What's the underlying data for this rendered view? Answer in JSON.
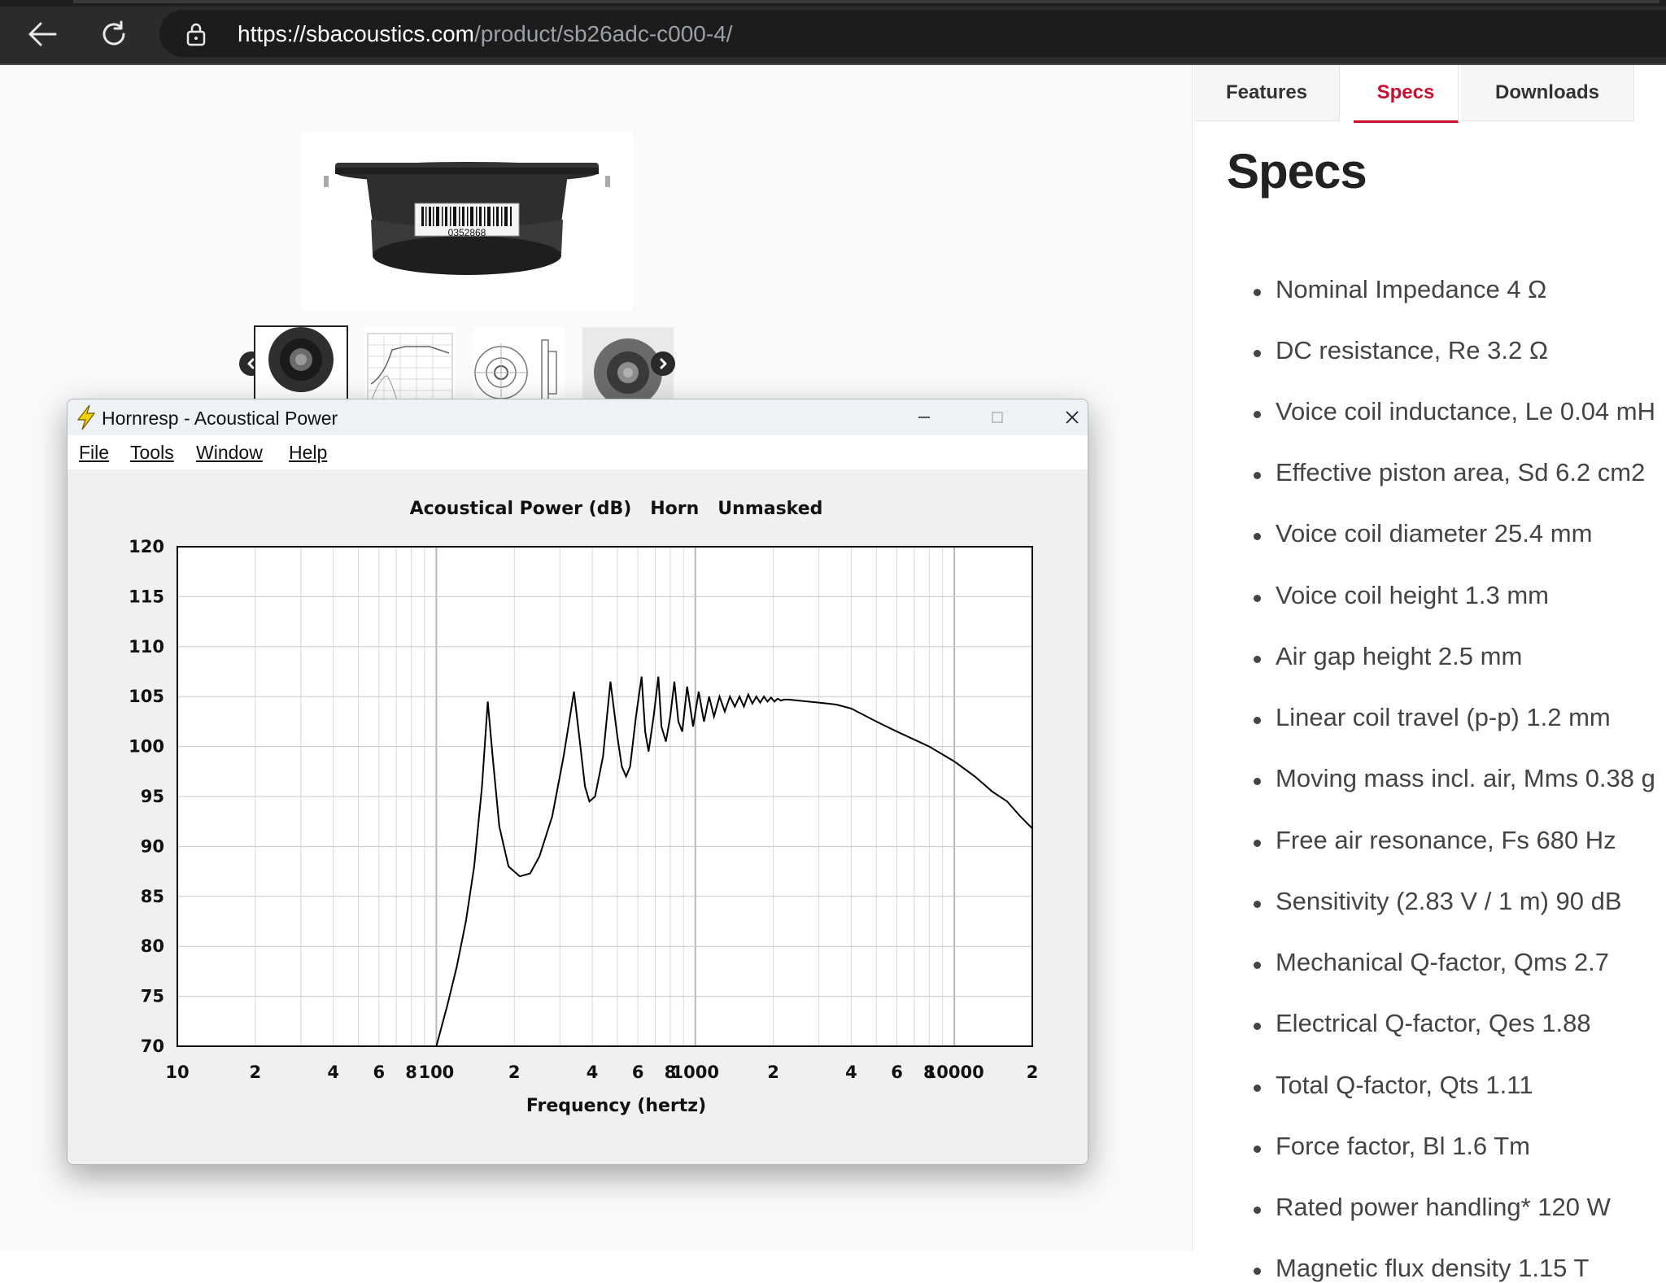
{
  "browser": {
    "url_host": "https://sbacoustics.com",
    "url_path": "/product/sb26adc-c000-4/"
  },
  "product": {
    "barcode_number": "0352868"
  },
  "tabs": [
    {
      "label": "Features"
    },
    {
      "label": "Specs"
    },
    {
      "label": "Downloads"
    }
  ],
  "specs": {
    "title": "Specs",
    "items": [
      "Nominal Impedance 4 Ω",
      "DC resistance, Re 3.2 Ω",
      "Voice coil inductance, Le 0.04 mH",
      "Effective piston area, Sd 6.2 cm2",
      "Voice coil diameter 25.4 mm",
      "Voice coil height 1.3 mm",
      "Air gap height 2.5 mm",
      "Linear coil travel (p-p) 1.2 mm",
      "Moving mass incl. air, Mms 0.38 g",
      "Free air resonance, Fs 680 Hz",
      "Sensitivity (2.83 V / 1 m) 90 dB",
      "Mechanical Q-factor, Qms 2.7",
      "Electrical Q-factor, Qes 1.88",
      "Total Q-factor, Qts 1.11",
      "Force factor, Bl 1.6 Tm",
      "Rated power handling* 120 W",
      "Magnetic flux density 1.15 T"
    ]
  },
  "hornresp": {
    "window_title": "Hornresp - Acoustical Power",
    "menu": [
      "File",
      "Tools",
      "Window",
      "Help"
    ]
  },
  "colors": {
    "accent": "#c8102e",
    "browser_bar": "#2b2b2b"
  },
  "chart_data": {
    "type": "line",
    "title": "Acoustical Power (dB)   Horn   Unmasked",
    "xlabel": "Frequency (hertz)",
    "ylabel": "",
    "x_scale": "log",
    "xlim": [
      10,
      20000
    ],
    "ylim": [
      70,
      120
    ],
    "y_ticks": [
      70,
      75,
      80,
      85,
      90,
      95,
      100,
      105,
      110,
      115,
      120
    ],
    "x_tick_labels": [
      {
        "value": 10,
        "label": "10"
      },
      {
        "value": 20,
        "label": "2"
      },
      {
        "value": 40,
        "label": "4"
      },
      {
        "value": 60,
        "label": "6"
      },
      {
        "value": 80,
        "label": "8"
      },
      {
        "value": 100,
        "label": "100"
      },
      {
        "value": 200,
        "label": "2"
      },
      {
        "value": 400,
        "label": "4"
      },
      {
        "value": 600,
        "label": "6"
      },
      {
        "value": 800,
        "label": "8"
      },
      {
        "value": 1000,
        "label": "1000"
      },
      {
        "value": 2000,
        "label": "2"
      },
      {
        "value": 4000,
        "label": "4"
      },
      {
        "value": 6000,
        "label": "6"
      },
      {
        "value": 8000,
        "label": "8"
      },
      {
        "value": 10000,
        "label": "10000"
      },
      {
        "value": 20000,
        "label": "2"
      }
    ],
    "grid": true,
    "series": [
      {
        "x": [
          100,
          110,
          120,
          130,
          140,
          150,
          158,
          165,
          175,
          190,
          210,
          230,
          250,
          280,
          310,
          340,
          360,
          375,
          390,
          410,
          440,
          470,
          500,
          520,
          540,
          560,
          590,
          620,
          640,
          660,
          690,
          720,
          740,
          770,
          800,
          830,
          860,
          890,
          930,
          980,
          1030,
          1080,
          1130,
          1180,
          1240,
          1300,
          1360,
          1420,
          1480,
          1540,
          1600,
          1660,
          1720,
          1780,
          1840,
          1900,
          1960,
          2020,
          2080,
          2140,
          2200,
          2300,
          2500,
          3000,
          3500,
          4000,
          5000,
          6000,
          8000,
          10000,
          12000,
          14000,
          16000,
          18000,
          20000
        ],
        "y": [
          70,
          74,
          78,
          82.5,
          88,
          96,
          104.5,
          99,
          92,
          88,
          87,
          87.3,
          89,
          93,
          99,
          105.5,
          100,
          96,
          94.5,
          95,
          99,
          106.5,
          101,
          98,
          97,
          98,
          103,
          107,
          101.5,
          99.5,
          103,
          107,
          102,
          100.5,
          103,
          106.5,
          102.5,
          101.5,
          106,
          102,
          105.5,
          102.5,
          105,
          103,
          105,
          103.5,
          105,
          104,
          105,
          104,
          105.2,
          104.3,
          105,
          104.4,
          105,
          104.5,
          104.9,
          104.5,
          104.8,
          104.6,
          104.7,
          104.7,
          104.6,
          104.4,
          104.2,
          103.8,
          102.5,
          101.5,
          100,
          98.5,
          97,
          95.5,
          94.5,
          93,
          91.8
        ]
      }
    ]
  }
}
